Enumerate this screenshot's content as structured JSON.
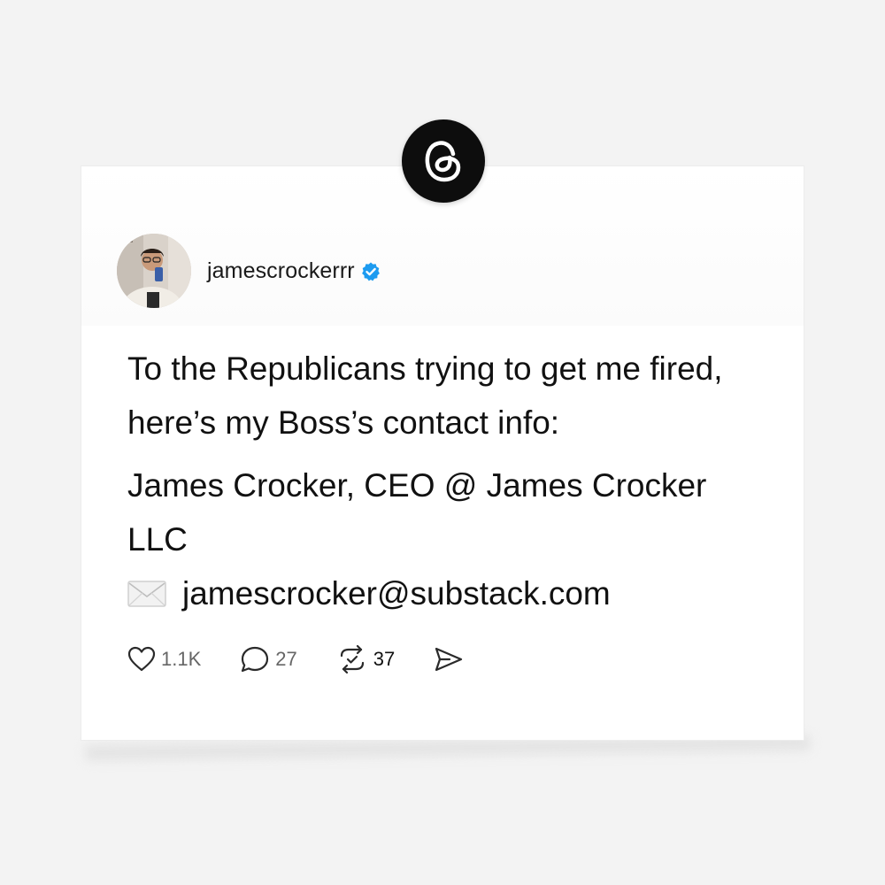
{
  "post": {
    "username": "jamescrockerrr",
    "paragraphs": [
      "To the Republicans trying to get me fired, here’s my Boss’s contact info:",
      "James Crocker, CEO @ James Crocker LLC"
    ],
    "email": "jamescrocker@substack.com",
    "stats": {
      "likes": "1.1K",
      "replies": "27",
      "reposts": "37"
    }
  },
  "icons": {
    "logo": "threads-logo-icon",
    "verified": "verified-badge-icon",
    "email": "envelope-icon",
    "like": "heart-icon",
    "reply": "comment-icon",
    "repost": "repost-icon",
    "share": "send-icon"
  },
  "colors": {
    "background": "#f3f3f3",
    "card": "#ffffff",
    "verified": "#1d9bf0",
    "logo_bg": "#0d0d0d"
  }
}
